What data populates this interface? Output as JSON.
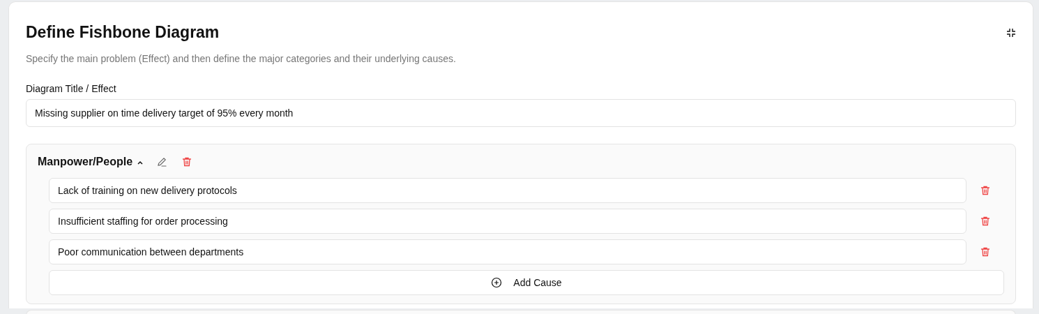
{
  "title": "Define Fishbone Diagram",
  "description": "Specify the main problem (Effect) and then define the major categories and their underlying causes.",
  "effect_field": {
    "label": "Diagram Title / Effect",
    "value": "Missing supplier on time delivery target of 95% every month"
  },
  "categories": [
    {
      "name": "Manpower/People",
      "expanded": true,
      "causes": [
        "Lack of training on new delivery protocols",
        "Insufficient staffing for order processing",
        "Poor communication between departments"
      ],
      "add_button": "Add Cause"
    },
    {
      "kind": "partial"
    }
  ]
}
